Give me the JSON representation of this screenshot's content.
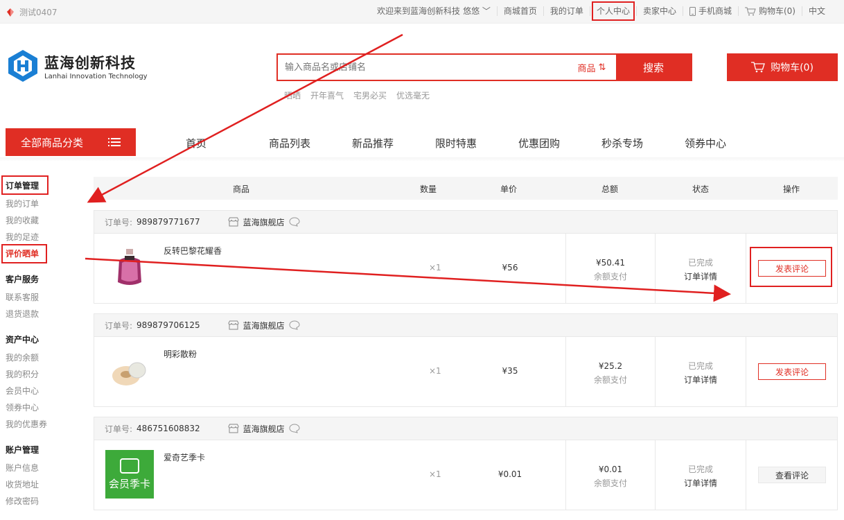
{
  "topbar": {
    "location": "测试0407",
    "welcome": "欢迎来到蓝海创新科技",
    "user": "悠悠",
    "links": [
      "商城首页",
      "我的订单",
      "个人中心",
      "卖家中心",
      "手机商城",
      "购物车(0)",
      "中文"
    ]
  },
  "brand": {
    "name_cn": "蓝海创新科技",
    "name_en": "Lanhai Innovation Technology"
  },
  "search": {
    "placeholder": "输入商品名或店铺名",
    "type_label": "商品",
    "button_label": "搜索",
    "hotwords": [
      "晒晒",
      "开年喜气",
      "宅男必买",
      "优选毫无"
    ]
  },
  "cart": {
    "label": "购物车(0)"
  },
  "category_button": "全部商品分类",
  "nav": [
    "首页",
    "商品列表",
    "新品推荐",
    "限时特惠",
    "优惠团购",
    "秒杀专场",
    "领券中心"
  ],
  "sidebar": [
    {
      "title": "订单管理",
      "items": [
        "我的订单",
        "我的收藏",
        "我的足迹",
        "评价晒单"
      ]
    },
    {
      "title": "客户服务",
      "items": [
        "联系客服",
        "退货退款"
      ]
    },
    {
      "title": "资产中心",
      "items": [
        "我的余额",
        "我的积分",
        "会员中心",
        "领券中心",
        "我的优惠券"
      ]
    },
    {
      "title": "账户管理",
      "items": [
        "账户信息",
        "收货地址",
        "修改密码"
      ]
    }
  ],
  "table_headers": [
    "商品",
    "数量",
    "单价",
    "总额",
    "状态",
    "操作"
  ],
  "order_labels": {
    "order_no": "订单号:",
    "pay_method": "余额支付",
    "detail": "订单详情"
  },
  "orders": [
    {
      "no": "989879771677",
      "shop": "蓝海旗舰店",
      "product": "反转巴黎花耀香",
      "qty": "×1",
      "price": "¥56",
      "total": "¥50.41",
      "status": "已完成",
      "action": "发表评论"
    },
    {
      "no": "989879706125",
      "shop": "蓝海旗舰店",
      "product": "明彩散粉",
      "qty": "×1",
      "price": "¥35",
      "total": "¥25.2",
      "status": "已完成",
      "action": "发表评论"
    },
    {
      "no": "486751608832",
      "shop": "蓝海旗舰店",
      "product": "爱奇艺季卡",
      "qty": "×1",
      "price": "¥0.01",
      "total": "¥0.01",
      "status": "已完成",
      "action": "查看评论",
      "thumb_text": "会员季卡"
    }
  ],
  "colors": {
    "accent": "#e02e24",
    "annotation": "#e02020"
  }
}
